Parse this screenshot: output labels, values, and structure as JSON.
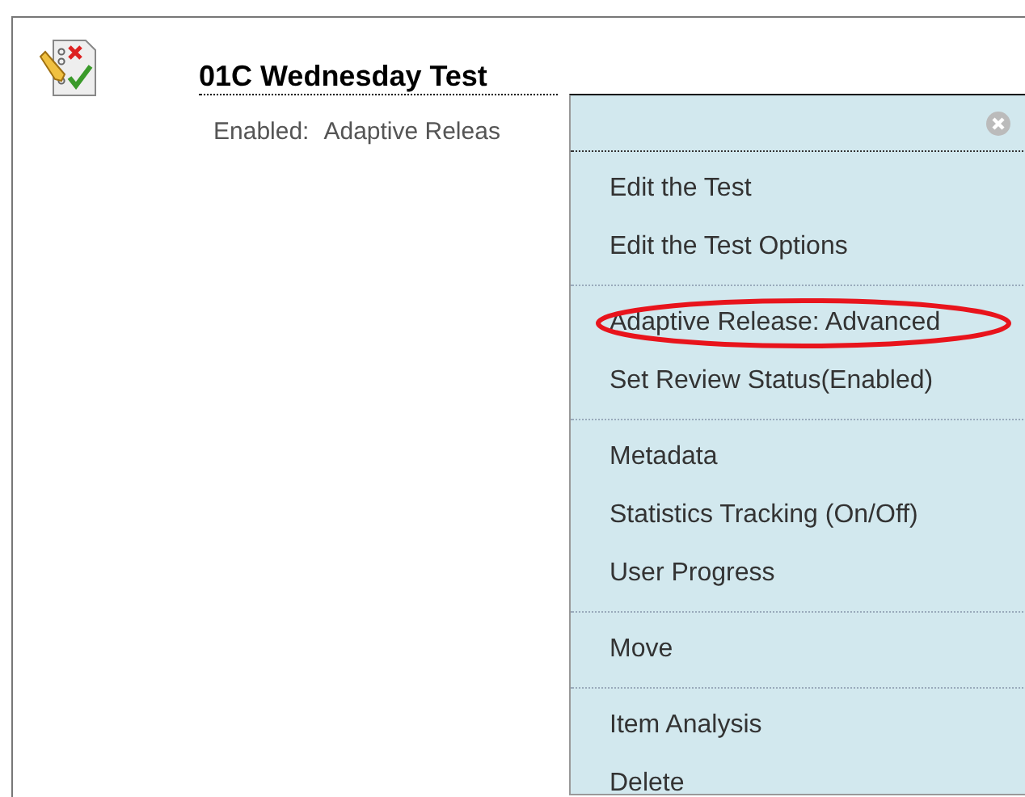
{
  "item": {
    "title": "01C Wednesday Test",
    "status_label": "Enabled:",
    "status_value": "Adaptive Releas"
  },
  "menu": {
    "groups": [
      [
        {
          "label": "Edit the Test",
          "highlighted": false
        },
        {
          "label": "Edit the Test Options",
          "highlighted": false
        }
      ],
      [
        {
          "label": "Adaptive Release: Advanced",
          "highlighted": true
        },
        {
          "label": "Set Review Status(Enabled)",
          "highlighted": false
        }
      ],
      [
        {
          "label": "Metadata",
          "highlighted": false
        },
        {
          "label": "Statistics Tracking (On/Off)",
          "highlighted": false
        },
        {
          "label": "User Progress",
          "highlighted": false
        }
      ],
      [
        {
          "label": "Move",
          "highlighted": false
        }
      ],
      [
        {
          "label": "Item Analysis",
          "highlighted": false
        },
        {
          "label": "Delete",
          "highlighted": false
        }
      ]
    ]
  }
}
